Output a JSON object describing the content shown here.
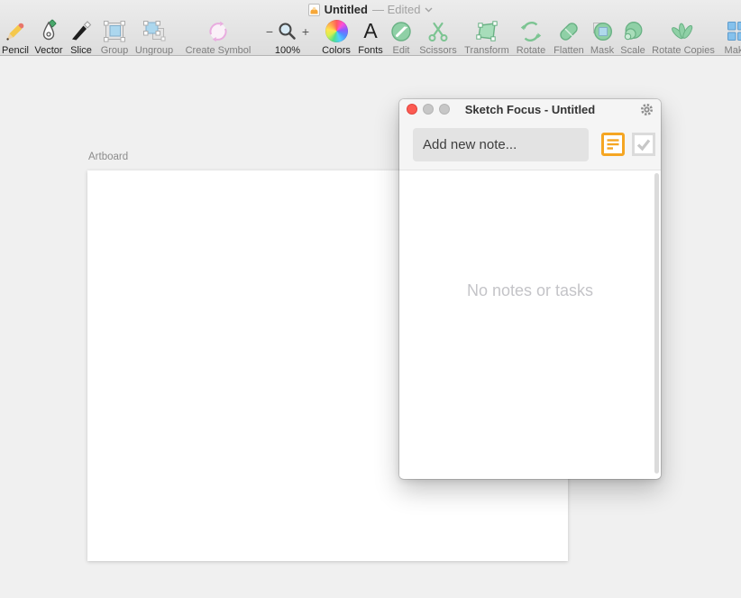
{
  "titlebar": {
    "document_icon": "document-icon",
    "title": "Untitled",
    "status": "— Edited",
    "chevron_icon": "chevron-down-icon"
  },
  "toolbar": {
    "items": [
      {
        "label": "Pencil",
        "icon": "pencil-icon",
        "enabled": true
      },
      {
        "label": "Vector",
        "icon": "vector-pen-icon",
        "enabled": true
      },
      {
        "label": "Slice",
        "icon": "slice-knife-icon",
        "enabled": true
      },
      {
        "label": "Group",
        "icon": "group-icon",
        "enabled": false
      },
      {
        "label": "Ungroup",
        "icon": "ungroup-icon",
        "enabled": false
      },
      {
        "label": "Create Symbol",
        "icon": "create-symbol-icon",
        "enabled": false
      },
      {
        "label": "Colors",
        "icon": "colors-wheel-icon",
        "enabled": true
      },
      {
        "label": "Fonts",
        "icon": "fonts-a-icon",
        "enabled": true
      },
      {
        "label": "Edit",
        "icon": "edit-icon",
        "enabled": false
      },
      {
        "label": "Scissors",
        "icon": "scissors-icon",
        "enabled": false
      },
      {
        "label": "Transform",
        "icon": "transform-icon",
        "enabled": false
      },
      {
        "label": "Rotate",
        "icon": "rotate-icon",
        "enabled": false
      },
      {
        "label": "Flatten",
        "icon": "flatten-icon",
        "enabled": false
      },
      {
        "label": "Mask",
        "icon": "mask-icon",
        "enabled": false
      },
      {
        "label": "Scale",
        "icon": "scale-icon",
        "enabled": false
      },
      {
        "label": "Rotate Copies",
        "icon": "rotate-copies-icon",
        "enabled": false
      },
      {
        "label": "Make",
        "icon": "make-grid-icon",
        "enabled": false
      }
    ],
    "zoom": {
      "minus": "−",
      "plus": "+",
      "level": "100%",
      "icon": "zoom-magnifier-icon"
    }
  },
  "canvas": {
    "artboard_label": "Artboard"
  },
  "focus_panel": {
    "title": "Sketch Focus - Untitled",
    "traffic_lights": [
      "close",
      "minimize",
      "zoom"
    ],
    "gear_icon": "gear-icon",
    "note_input_placeholder": "Add new note...",
    "note_mode_icon": "note-lines-icon",
    "task_mode_icon": "checkmark-icon",
    "empty_state": "No notes or tasks",
    "accent_color": "#F5A623"
  }
}
